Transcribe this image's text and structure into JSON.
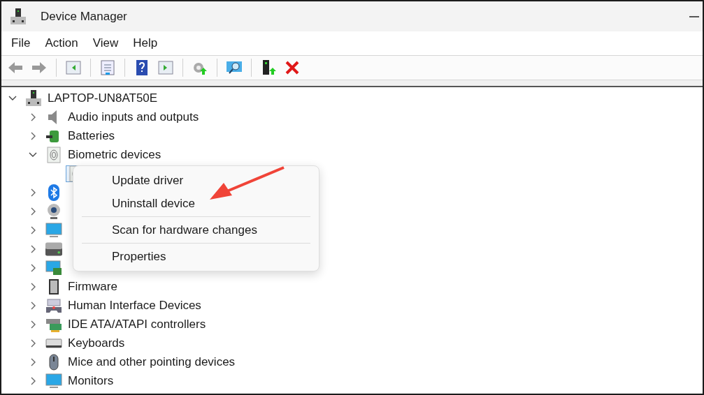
{
  "window": {
    "title": "Device Manager"
  },
  "menu_bar": [
    "File",
    "Action",
    "View",
    "Help"
  ],
  "tree": {
    "label": "LAPTOP-UN8AT50E",
    "expanded": true,
    "children": [
      {
        "label": "Audio inputs and outputs",
        "expanded": false
      },
      {
        "label": "Batteries",
        "expanded": false
      },
      {
        "label": "Biometric devices",
        "expanded": true,
        "children": [
          {
            "selected": true
          }
        ]
      },
      {
        "expanded": false
      },
      {
        "expanded": false
      },
      {
        "expanded": false
      },
      {
        "expanded": false
      },
      {
        "expanded": false
      },
      {
        "label": "Firmware",
        "expanded": false
      },
      {
        "label": "Human Interface Devices",
        "expanded": false
      },
      {
        "label": "IDE ATA/ATAPI controllers",
        "expanded": false
      },
      {
        "label": "Keyboards",
        "expanded": false
      },
      {
        "label": "Mice and other pointing devices",
        "expanded": false
      },
      {
        "label": "Monitors",
        "expanded": false
      }
    ]
  },
  "context_menu": {
    "groups": [
      [
        "Update driver",
        "Uninstall device"
      ],
      [
        "Scan for hardware changes"
      ],
      [
        "Properties"
      ]
    ]
  }
}
